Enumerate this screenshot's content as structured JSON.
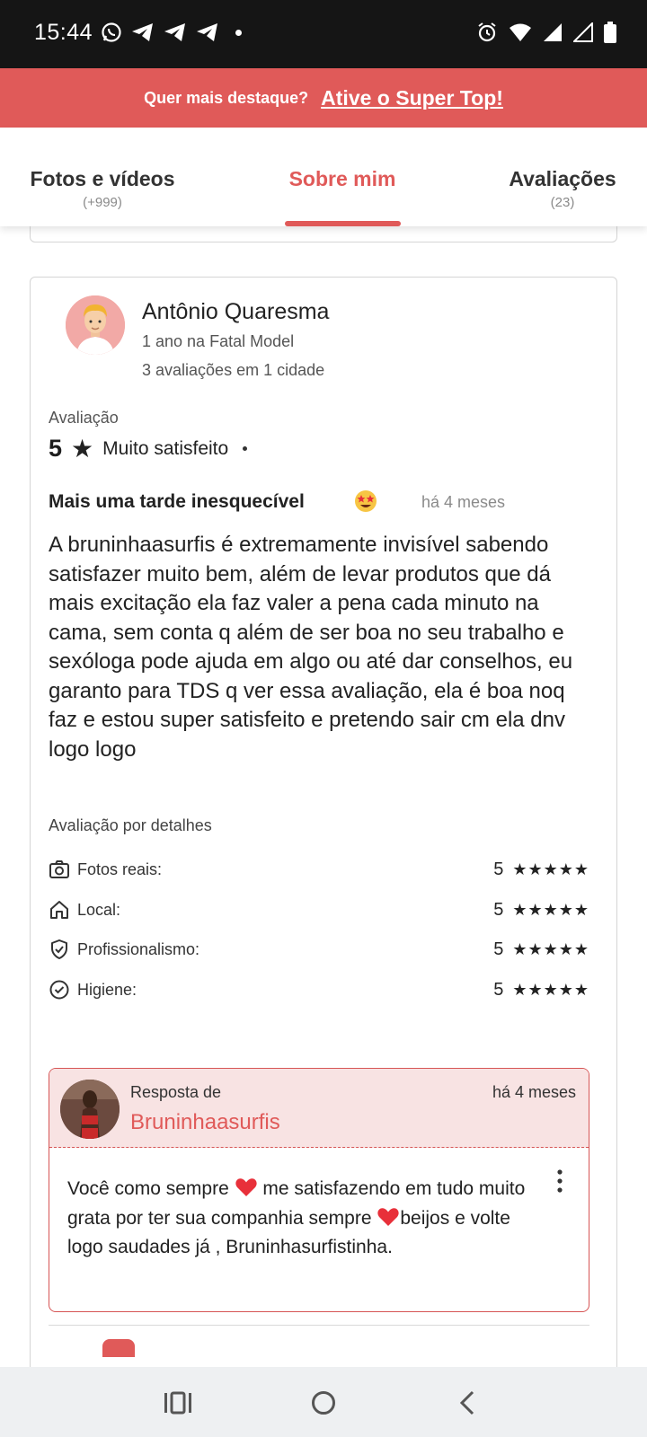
{
  "status_bar": {
    "time": "15:44",
    "icons_left": [
      "whatsapp-icon",
      "telegram-icon",
      "telegram-icon",
      "telegram-icon",
      "dot-icon"
    ],
    "icons_right": [
      "alarm-icon",
      "wifi-icon",
      "signal-icon",
      "signal-icon",
      "battery-icon"
    ]
  },
  "promo": {
    "question": "Quer mais destaque?",
    "link": "Ative o Super Top!"
  },
  "tabs": [
    {
      "label": "Fotos e vídeos",
      "sub": "(+999)"
    },
    {
      "label": "Sobre mim",
      "sub": ""
    },
    {
      "label": "Avaliações",
      "sub": "(23)"
    }
  ],
  "active_tab": "Sobre mim",
  "review": {
    "reviewer_name": "Antônio Quaresma",
    "member_since": "1 ano na Fatal Model",
    "reviews_count": "3 avaliações em 1 cidade",
    "rating_label": "Avaliação",
    "rating_value": "5",
    "rating_text": "Muito satisfeito",
    "title": "Mais uma tarde inesquecível",
    "title_emoji": "star-struck-emoji",
    "time": "há 4 meses",
    "body": "A bruninhaasurfis é extremamente invisível sabendo satisfazer muito bem, além de levar produtos que dá mais excitação ela faz valer a pena cada minuto na cama, sem conta q além de ser boa no seu trabalho e sexóloga pode ajuda em algo ou até dar conselhos, eu garanto para TDS q ver essa avaliação, ela é boa noq faz e estou super satisfeito e pretendo sair cm ela dnv logo logo",
    "details_label": "Avaliação por detalhes",
    "details": [
      {
        "icon": "camera-icon",
        "label": "Fotos reais:",
        "value": "5",
        "stars": "★★★★★"
      },
      {
        "icon": "home-icon",
        "label": "Local:",
        "value": "5",
        "stars": "★★★★★"
      },
      {
        "icon": "shield-check-icon",
        "label": "Profissionalismo:",
        "value": "5",
        "stars": "★★★★★"
      },
      {
        "icon": "check-circle-icon",
        "label": "Higiene:",
        "value": "5",
        "stars": "★★★★★"
      }
    ]
  },
  "reply": {
    "from_label": "Resposta de",
    "author": "Bruninhaasurfis",
    "time": "há 4 meses",
    "body_parts": [
      "Você como sempre ",
      " me satisfazendo em tudo muito grata por ter sua companhia sempre ",
      "beijos e volte logo saudades já , Bruninhasurfistinha."
    ],
    "emoji": "red-heart-emoji"
  },
  "colors": {
    "accent": "#e05a59",
    "status_bar": "#151515",
    "reply_bg": "#f8e3e3",
    "nav_bar": "#eef0f2"
  },
  "nav_bar": {
    "buttons": [
      "recent-apps-icon",
      "home-circle-icon",
      "back-icon"
    ]
  }
}
